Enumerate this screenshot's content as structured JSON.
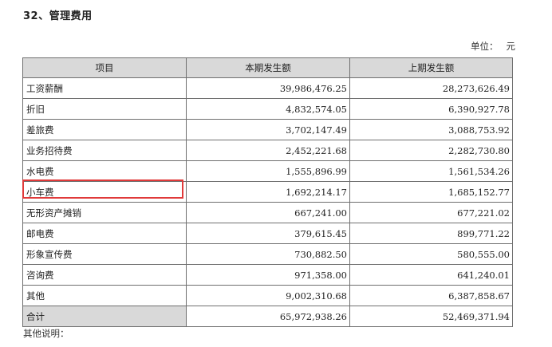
{
  "section_title": "32、管理费用",
  "unit_label": "单位：",
  "unit_value": "元",
  "table": {
    "headers": [
      "项目",
      "本期发生额",
      "上期发生额"
    ],
    "rows": [
      {
        "item": "工资薪酬",
        "current": "39,986,476.25",
        "previous": "28,273,626.49"
      },
      {
        "item": "折旧",
        "current": "4,832,574.05",
        "previous": "6,390,927.78"
      },
      {
        "item": "差旅费",
        "current": "3,702,147.49",
        "previous": "3,088,753.92"
      },
      {
        "item": "业务招待费",
        "current": "2,452,221.68",
        "previous": "2,282,730.80"
      },
      {
        "item": "水电费",
        "current": "1,555,896.99",
        "previous": "1,561,534.26"
      },
      {
        "item": "小车费",
        "current": "1,692,214.17",
        "previous": "1,685,152.77"
      },
      {
        "item": "无形资产摊销",
        "current": "667,241.00",
        "previous": "677,221.02"
      },
      {
        "item": "邮电费",
        "current": "379,615.45",
        "previous": "899,771.22"
      },
      {
        "item": "形象宣传费",
        "current": "730,882.50",
        "previous": "580,555.00"
      },
      {
        "item": "咨询费",
        "current": "971,358.00",
        "previous": "641,240.01"
      },
      {
        "item": "其他",
        "current": "9,002,310.68",
        "previous": "6,387,858.67"
      }
    ],
    "total": {
      "item": "合计",
      "current": "65,972,938.26",
      "previous": "52,469,371.94"
    }
  },
  "highlight_color": "#e03a3a",
  "footnote": "其他说明："
}
